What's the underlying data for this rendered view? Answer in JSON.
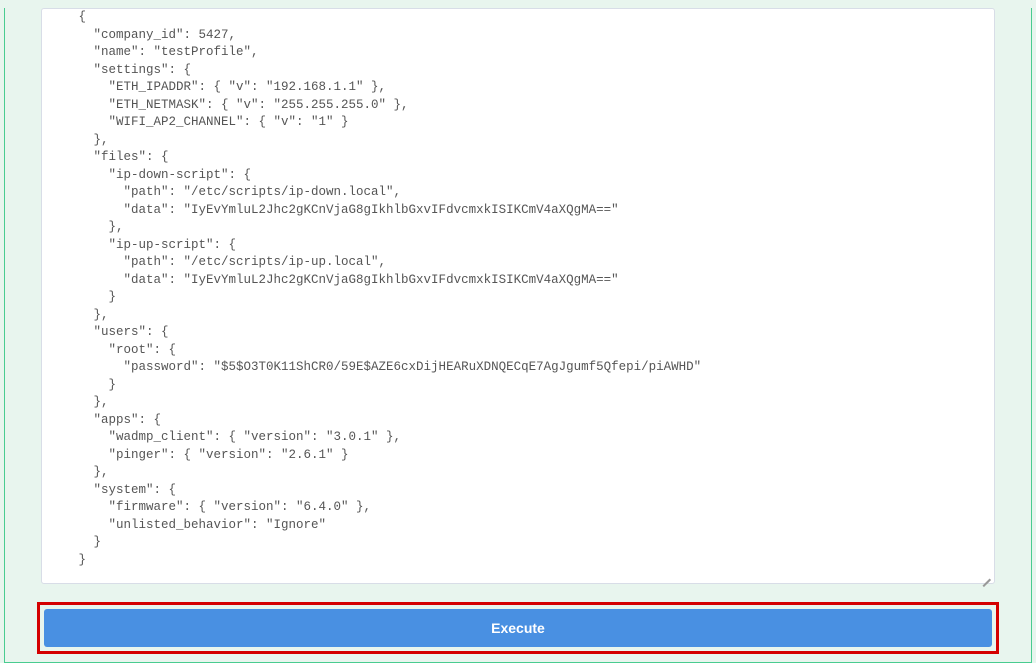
{
  "json_display": "   {\n     \"company_id\": 5427,\n     \"name\": \"testProfile\",\n     \"settings\": {\n       \"ETH_IPADDR\": { \"v\": \"192.168.1.1\" },\n       \"ETH_NETMASK\": { \"v\": \"255.255.255.0\" },\n       \"WIFI_AP2_CHANNEL\": { \"v\": \"1\" }\n     },\n     \"files\": {\n       \"ip-down-script\": {\n         \"path\": \"/etc/scripts/ip-down.local\",\n         \"data\": \"IyEvYmluL2Jhc2gKCnVjaG8gIkhlbGxvIFdvcmxkISIKCmV4aXQgMA==\"\n       },\n       \"ip-up-script\": {\n         \"path\": \"/etc/scripts/ip-up.local\",\n         \"data\": \"IyEvYmluL2Jhc2gKCnVjaG8gIkhlbGxvIFdvcmxkISIKCmV4aXQgMA==\"\n       }\n     },\n     \"users\": {\n       \"root\": {\n         \"password\": \"$5$O3T0K11ShCR0/59E$AZE6cxDijHEARuXDNQECqE7AgJgumf5Qfepi/piAWHD\"\n       }\n     },\n     \"apps\": {\n       \"wadmp_client\": { \"version\": \"3.0.1\" },\n       \"pinger\": { \"version\": \"2.6.1\" }\n     },\n     \"system\": {\n       \"firmware\": { \"version\": \"6.4.0\" },\n       \"unlisted_behavior\": \"Ignore\"\n     }\n   }",
  "buttons": {
    "execute": "Execute"
  }
}
